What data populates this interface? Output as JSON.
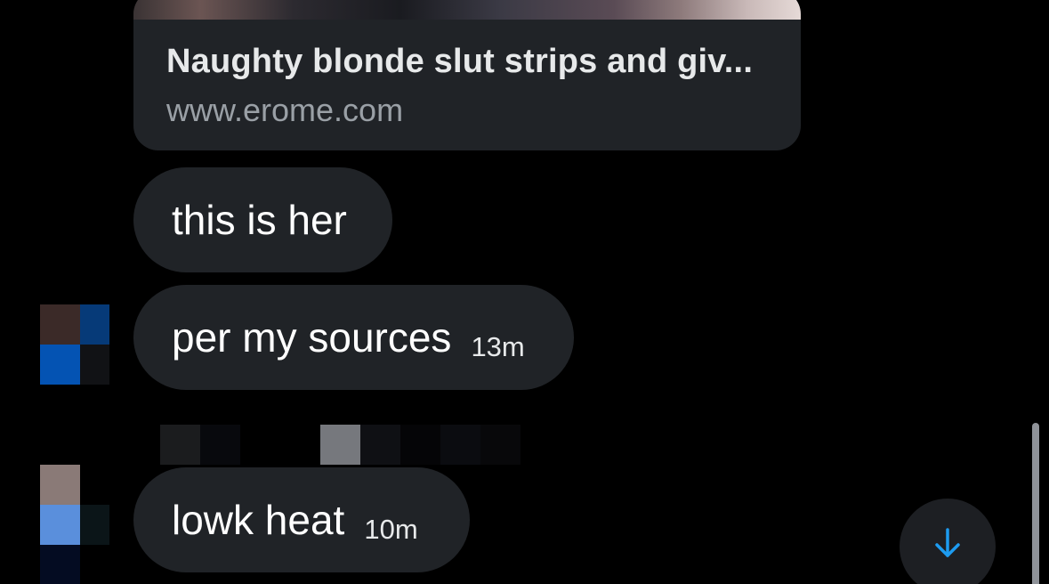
{
  "link_preview": {
    "title": "Naughty blonde slut strips and giv...",
    "domain": "www.erome.com"
  },
  "messages": [
    {
      "text": "this is her",
      "time": ""
    },
    {
      "text": "per my sources",
      "time": "13m"
    },
    {
      "text": "lowk heat",
      "time": "10m"
    }
  ],
  "colors": {
    "background": "#000000",
    "bubble": "#202327",
    "accent": "#1d9bf0"
  },
  "icons": {
    "scroll_button": "arrow-down-icon"
  },
  "avatar1_pixels": [
    "#3b2a28",
    "#063a78",
    "#0453b3",
    "#111215"
  ],
  "avatar2_pixels": [
    "#8a7a77",
    "#000000",
    "#5a8fdc",
    "#0b1518",
    "#040c22",
    "#000000"
  ],
  "name_strip_pixels": [
    "#1b1c1e",
    "#08090d",
    "#000000",
    "#000000",
    "#76787d",
    "#0f1014",
    "#050507",
    "#0b0c10",
    "#08080a"
  ]
}
